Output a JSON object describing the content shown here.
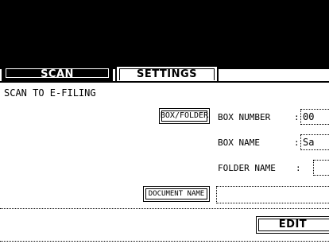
{
  "tabs": {
    "scan_label": "SCAN",
    "settings_label": "SETTINGS"
  },
  "section_title": "SCAN TO E-FILING",
  "buttons": {
    "box_folder": "BOX/FOLDER",
    "document_name": "DOCUMENT NAME",
    "edit": "EDIT"
  },
  "fields": {
    "box_number": {
      "label": "BOX NUMBER",
      "separator": ":",
      "value": "00"
    },
    "box_name": {
      "label": "BOX NAME",
      "separator": ":",
      "value": "Sa"
    },
    "folder_name": {
      "label": "FOLDER NAME",
      "separator": ":",
      "value": ""
    },
    "document_name": {
      "value": ""
    }
  },
  "colors": {
    "background": "#ffffff",
    "foreground": "#000000",
    "active_tab": "#000000"
  }
}
